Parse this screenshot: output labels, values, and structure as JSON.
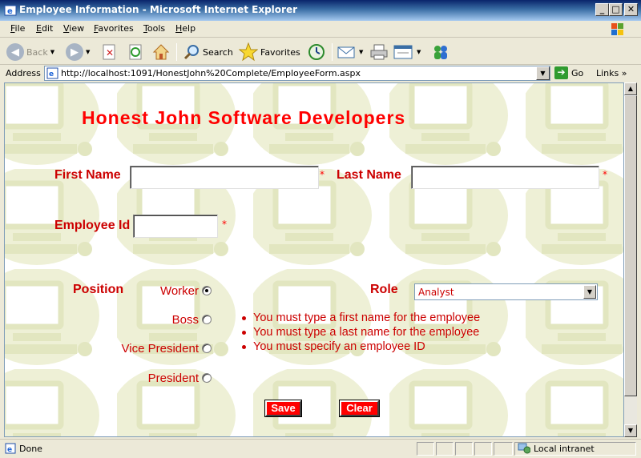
{
  "window": {
    "title": "Employee Information - Microsoft Internet Explorer"
  },
  "menu": [
    "File",
    "Edit",
    "View",
    "Favorites",
    "Tools",
    "Help"
  ],
  "toolbar": {
    "back": "Back",
    "search": "Search",
    "favorites": "Favorites"
  },
  "address": {
    "label": "Address",
    "url": "http://localhost:1091/HonestJohn%20Complete/EmployeeForm.aspx",
    "go": "Go",
    "links": "Links"
  },
  "page": {
    "heading": "Honest John Software Developers",
    "first_name_label": "First Name",
    "last_name_label": "Last Name",
    "employee_id_label": "Employee Id",
    "required_marker": "*",
    "first_name_value": "",
    "last_name_value": "",
    "employee_id_value": "",
    "position_label": "Position",
    "positions": [
      "Worker",
      "Boss",
      "Vice President",
      "President"
    ],
    "selected_position": "Worker",
    "role_label": "Role",
    "role_value": "Analyst",
    "errors": [
      "You must type a first name for the employee",
      "You must type a last name for the employee",
      "You must specify an employee ID"
    ],
    "save_label": "Save",
    "clear_label": "Clear"
  },
  "status": {
    "text": "Done",
    "zone": "Local intranet"
  },
  "colors": {
    "accent": "#ff0000",
    "label": "#cc0000",
    "background_tile": "#e8ecc8"
  }
}
